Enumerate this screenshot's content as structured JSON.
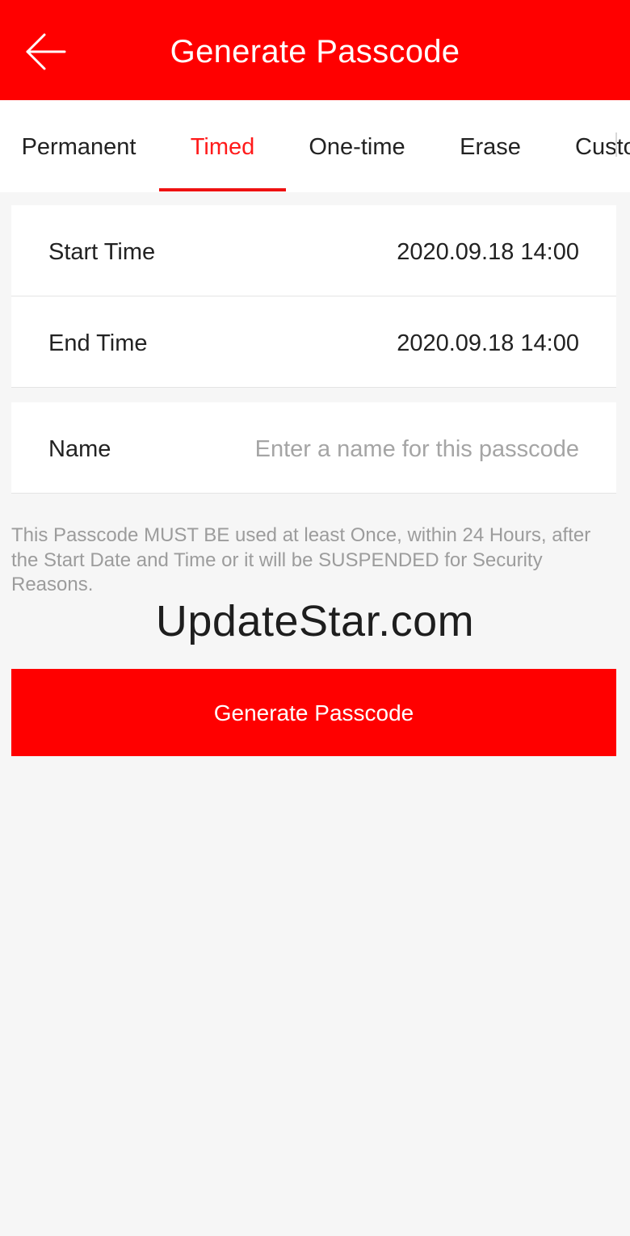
{
  "header": {
    "title": "Generate Passcode",
    "back_icon": "arrow-left-icon",
    "background": "#ff0000"
  },
  "tabs": [
    {
      "label": "Permanent",
      "active": false
    },
    {
      "label": "Timed",
      "active": true
    },
    {
      "label": "One-time",
      "active": false
    },
    {
      "label": "Erase",
      "active": false
    },
    {
      "label": "Custo",
      "active": false
    }
  ],
  "time_card": {
    "start": {
      "label": "Start Time",
      "value": "2020.09.18 14:00"
    },
    "end": {
      "label": "End Time",
      "value": "2020.09.18 14:00"
    }
  },
  "name_card": {
    "label": "Name",
    "value": "",
    "placeholder": "Enter a name for this passcode"
  },
  "notice": "This Passcode MUST BE used at least Once, within 24 Hours, after the Start Date and Time or it will be SUSPENDED for Security Reasons.",
  "watermark": "UpdateStar.com",
  "generate_button": {
    "label": "Generate Passcode"
  },
  "colors": {
    "accent": "#ff0000",
    "active_tab": "#ff1a1a",
    "muted_text": "#9c9c9c",
    "background": "#f6f6f6"
  }
}
